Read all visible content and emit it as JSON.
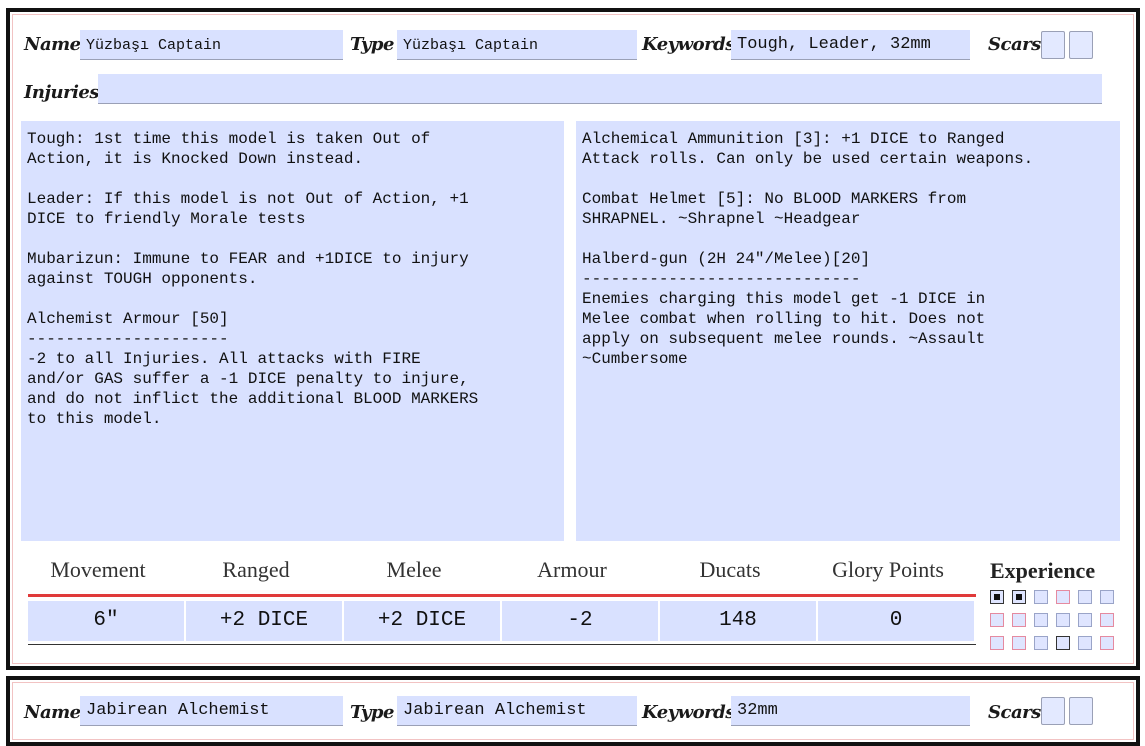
{
  "card1": {
    "name_label": "Name",
    "name_value": "Yüzbaşı Captain",
    "type_label": "Type",
    "type_value": "Yüzbaşı Captain",
    "keywords_label": "Keywords",
    "keywords_value": "Tough, Leader, 32mm",
    "scars_label": "Scars",
    "injuries_label": "Injuries",
    "injuries_value": "",
    "abilities_text": "Tough: 1st time this model is taken Out of\nAction, it is Knocked Down instead.\n\nLeader: If this model is not Out of Action, +1\nDICE to friendly Morale tests\n\nMubarizun: Immune to FEAR and +1DICE to injury\nagainst TOUGH opponents.\n\nAlchemist Armour [50]\n---------------------\n-2 to all Injuries. All attacks with FIRE\nand/or GAS suffer a -1 DICE penalty to injure,\nand do not inflict the additional BLOOD MARKERS\nto this model.",
    "equipment_text": "Alchemical Ammunition [3]: +1 DICE to Ranged\nAttack rolls. Can only be used certain weapons.\n\nCombat Helmet [5]: No BLOOD MARKERS from\nSHRAPNEL. ~Shrapnel ~Headgear\n\nHalberd-gun (2H 24\"/Melee)[20]\n-----------------------------\nEnemies charging this model get -1 DICE in\nMelee combat when rolling to hit. Does not\napply on subsequent melee rounds. ~Assault\n~Cumbersome",
    "stats": {
      "headers": [
        "Movement",
        "Ranged",
        "Melee",
        "Armour",
        "Ducats",
        "Glory Points"
      ],
      "values": [
        "6\"",
        "+2 DICE",
        "+2 DICE",
        "-2",
        "148",
        "0"
      ]
    },
    "experience_label": "Experience",
    "experience_checked": 2,
    "experience_total": 18
  },
  "card2": {
    "name_label": "Name",
    "name_value": "Jabirean Alchemist",
    "type_label": "Type",
    "type_value": "Jabirean Alchemist",
    "keywords_label": "Keywords",
    "keywords_value": "32mm",
    "scars_label": "Scars"
  }
}
